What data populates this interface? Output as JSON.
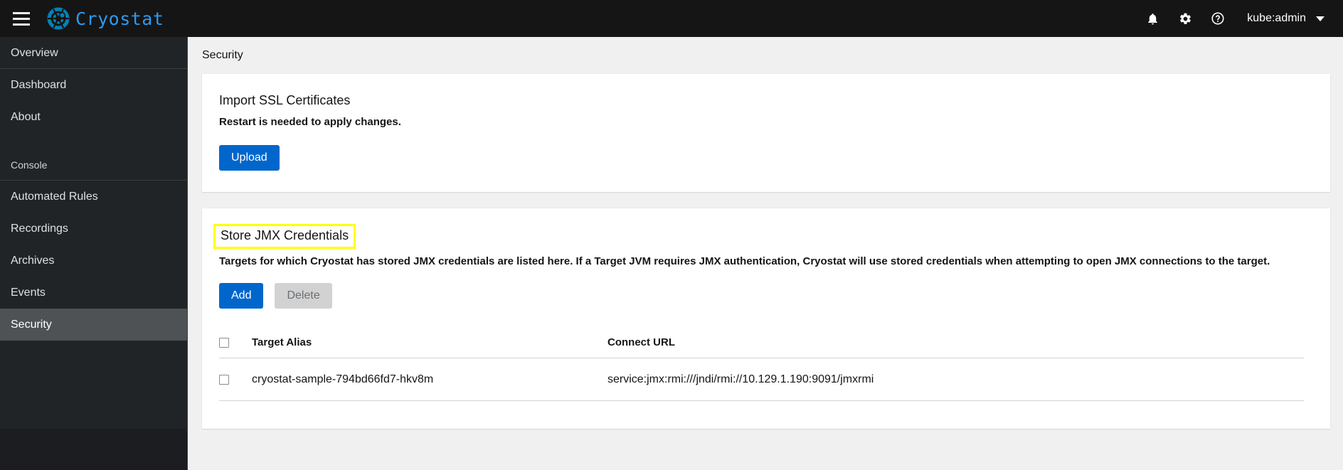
{
  "masthead": {
    "menu_icon": "hamburger-icon",
    "brand_name": "Cryostat",
    "brand_logo_icon": "cryostat-logo-icon",
    "notifications_icon": "bell-icon",
    "settings_icon": "gear-icon",
    "help_icon": "help-circle-icon",
    "user_name": "kube:admin",
    "user_caret_icon": "caret-down-icon",
    "background_color": "#151515",
    "brand_color": "#2b9af3"
  },
  "sidebar": {
    "background_color": "#212427",
    "selected_color": "#4f5255",
    "items": [
      {
        "label": "Overview",
        "selected": false
      },
      {
        "label": "Dashboard",
        "selected": false
      },
      {
        "label": "About",
        "selected": false
      }
    ],
    "section_title": "Console",
    "console_items": [
      {
        "label": "Automated Rules",
        "selected": false
      },
      {
        "label": "Recordings",
        "selected": false
      },
      {
        "label": "Archives",
        "selected": false
      },
      {
        "label": "Events",
        "selected": false
      },
      {
        "label": "Security",
        "selected": true
      }
    ]
  },
  "main": {
    "page_title": "Security",
    "certificates_card": {
      "heading": "Import SSL Certificates",
      "subtext": "Restart is needed to apply changes.",
      "upload_button": "Upload"
    },
    "jmx_card": {
      "heading": "Store JMX Credentials",
      "heading_highlight_color": "#ffff00",
      "description": "Targets for which Cryostat has stored JMX credentials are listed here. If a Target JVM requires JMX authentication, Cryostat will use stored credentials when attempting to open JMX connections to the target.",
      "add_button": "Add",
      "delete_button": "Delete",
      "delete_disabled": true,
      "table": {
        "select_all_checkbox": "select-all-checkbox",
        "columns": [
          "Target Alias",
          "Connect URL"
        ],
        "rows": [
          {
            "checked": false,
            "target_alias": "cryostat-sample-794bd66fd7-hkv8m",
            "connect_url": "service:jmx:rmi:///jndi/rmi://10.129.1.190:9091/jmxrmi"
          }
        ]
      }
    }
  },
  "colors": {
    "primary_button": "#0066cc",
    "disabled_button": "#d2d2d2",
    "page_background": "#f0f0f0",
    "card_background": "#ffffff"
  }
}
